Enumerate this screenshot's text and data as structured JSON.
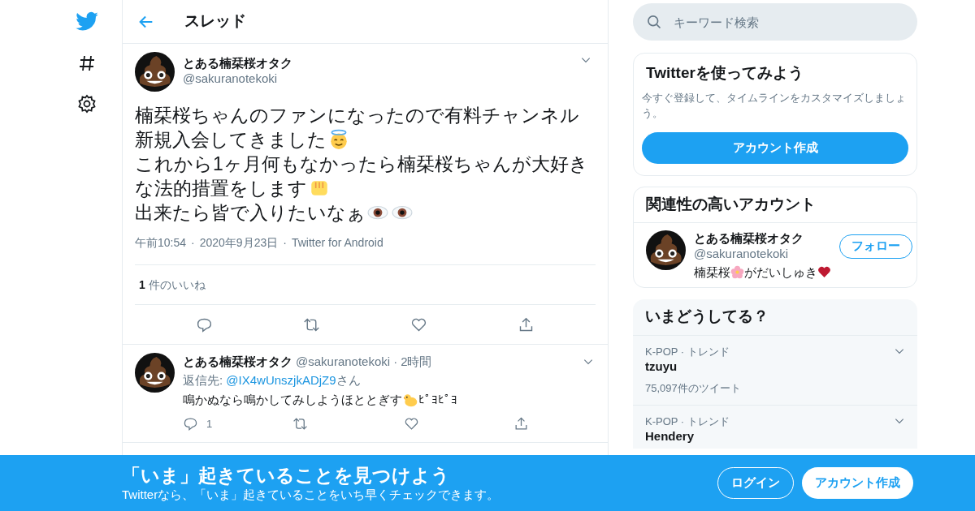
{
  "header": {
    "title": "スレッド"
  },
  "search": {
    "placeholder": "キーワード検索"
  },
  "tweet": {
    "name": "とある楠栞桜オタク",
    "handle": "@sakuranotekoki",
    "lines": [
      [
        {
          "kind": "text",
          "text": "楠栞桜ちゃんのファンになったので有料チャンネル"
        }
      ],
      [
        {
          "kind": "text",
          "text": "新規入会してきました"
        },
        {
          "kind": "halo"
        }
      ],
      [
        {
          "kind": "text",
          "text": "これから1ヶ月何もなかったら楠栞桜ちゃんが大好き"
        }
      ],
      [
        {
          "kind": "text",
          "text": "な法的措置をします"
        },
        {
          "kind": "fist"
        }
      ],
      [
        {
          "kind": "text",
          "text": "出来たら皆で入りたいなぁ"
        },
        {
          "kind": "eye"
        },
        {
          "kind": "eye"
        }
      ]
    ],
    "meta": [
      "午前10:54",
      "2020年9月23日",
      "Twitter for Android"
    ],
    "separator": "·",
    "likes_count": "1",
    "likes_label": "件のいいね"
  },
  "reply": {
    "name": "とある楠栞桜オタク",
    "handle": "@sakuranotekoki",
    "separator": "·",
    "time": "2時間",
    "reply_prefix": "返信先: ",
    "reply_to": "@IX4wUnszjkADjZ9",
    "reply_suffix": "さん",
    "body": [
      {
        "kind": "text",
        "text": "鳴かぬなら鳴かしてみしようほととぎす"
      },
      {
        "kind": "chick"
      },
      {
        "kind": "text",
        "text": "ﾋﾟﾖﾋﾟﾖ"
      }
    ],
    "reply_count": "1"
  },
  "signup_card": {
    "title": "Twitterを使ってみよう",
    "text": "今すぐ登録して、タイムラインをカスタマイズしましょう。",
    "button": "アカウント作成"
  },
  "related": {
    "title": "関連性の高いアカウント",
    "name": "とある楠栞桜オタク",
    "handle": "@sakuranotekoki",
    "follow": "フォロー",
    "bio": [
      {
        "kind": "text",
        "text": "楠栞桜"
      },
      {
        "kind": "blossom"
      },
      {
        "kind": "text",
        "text": "がだいしゅき"
      },
      {
        "kind": "heart"
      }
    ]
  },
  "trends": {
    "title": "いまどうしてる？",
    "items": [
      {
        "category": "K-POP · トレンド",
        "name": "tzuyu",
        "count": "75,097件のツイート"
      },
      {
        "category": "K-POP · トレンド",
        "name": "Hendery"
      }
    ]
  },
  "banner": {
    "title": "「いま」起きていることを見つけよう",
    "subtitle": "Twitterなら、「いま」起きていることをいち早くチェックできます。",
    "login": "ログイン",
    "signup": "アカウント作成"
  }
}
